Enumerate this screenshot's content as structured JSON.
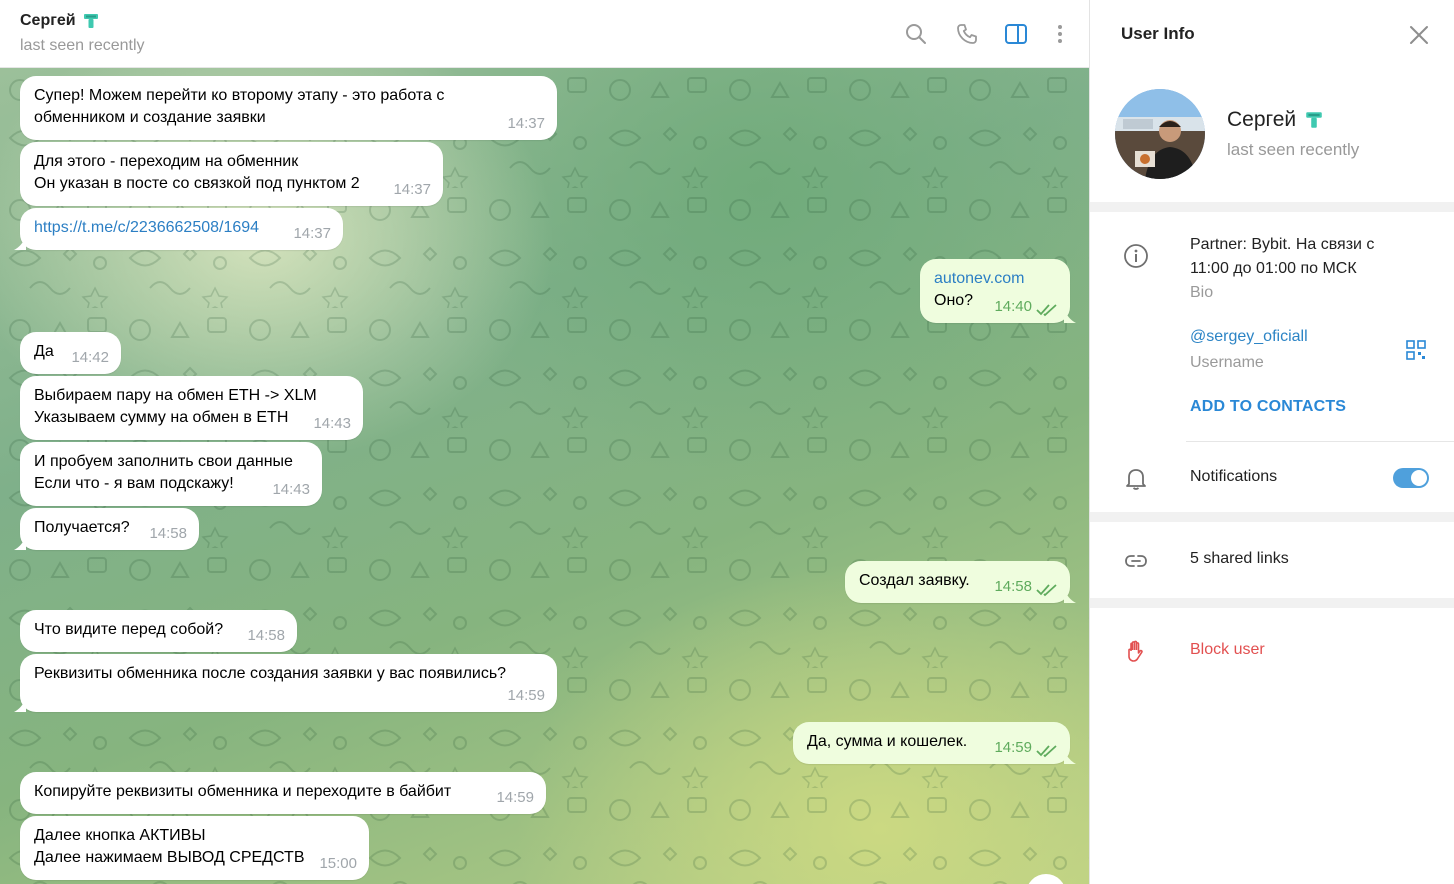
{
  "header": {
    "name": "Сергей",
    "status": "last seen recently",
    "icons": [
      "search-icon",
      "phone-icon",
      "sidebar-toggle-icon",
      "more-vertical-icon"
    ]
  },
  "messages": [
    {
      "dir": "in",
      "lines": "Супер! Можем перейти ко второму этапу - это работа с\nобменником и создание заявки",
      "time": "14:37"
    },
    {
      "dir": "in",
      "lines": "Для этого - переходим на обменник\nОн указан в посте со связкой под пунктом 2",
      "time": "14:37"
    },
    {
      "dir": "in",
      "link": "https://t.me/c/2236662508/1694",
      "time": "14:37"
    },
    {
      "dir": "out",
      "link": "autonev.com",
      "lines": "Оно?",
      "time": "14:40"
    },
    {
      "dir": "in",
      "lines": "Да",
      "time": "14:42"
    },
    {
      "dir": "in",
      "lines": "Выбираем пару на обмен ETH -> XLM\nУказываем сумму на обмен в ETH",
      "time": "14:43"
    },
    {
      "dir": "in",
      "lines": "И пробуем заполнить свои данные\nЕсли что - я вам подскажу!",
      "time": "14:43"
    },
    {
      "dir": "in",
      "lines": "Получается?",
      "time": "14:58"
    },
    {
      "dir": "out",
      "lines": "Создал заявку.",
      "time": "14:58"
    },
    {
      "dir": "in",
      "lines": "Что видите перед собой?",
      "time": "14:58"
    },
    {
      "dir": "in",
      "lines": "Реквизиты обменника после создания заявки у вас появились?",
      "time": "14:59"
    },
    {
      "dir": "out",
      "lines": "Да, сумма и кошелек.",
      "time": "14:59"
    },
    {
      "dir": "in",
      "lines": "Копируйте реквизиты обменника и переходите в байбит",
      "time": "14:59"
    },
    {
      "dir": "in",
      "lines": "Далее кнопка АКТИВЫ\nДалее нажимаем ВЫВОД СРЕДСТВ",
      "time": "15:00"
    }
  ],
  "panel": {
    "title": "User Info",
    "name": "Сергей",
    "status": "last seen recently",
    "bio": "Partner: Bybit. На связи с 11:00 до 01:00 по МСК",
    "bio_label": "Bio",
    "username": "@sergey_oficiall",
    "username_label": "Username",
    "add_contacts": "ADD TO CONTACTS",
    "notifications": "Notifications",
    "notifications_on": true,
    "shared_links": "5 shared links",
    "block": "Block user"
  },
  "colors": {
    "accent": "#2a88d6",
    "outgoing_bubble": "#effdde",
    "danger": "#e25050",
    "read_ticks": "#5fab5d"
  }
}
